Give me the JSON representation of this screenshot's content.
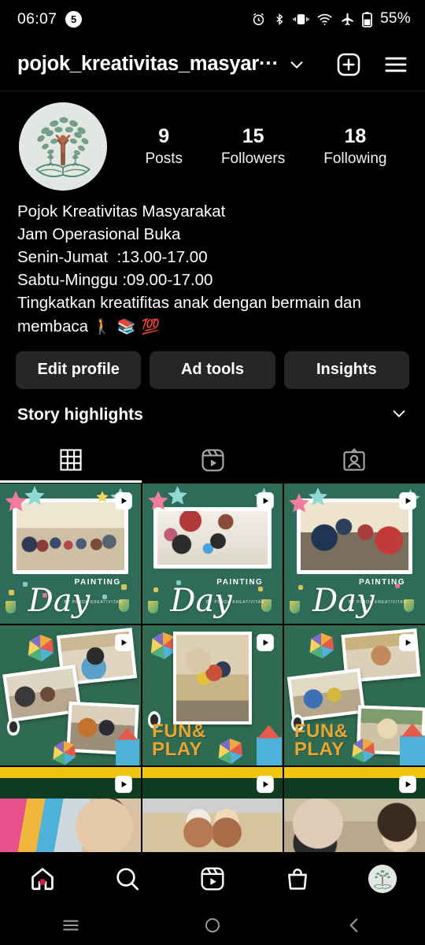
{
  "status_bar": {
    "time": "06:07",
    "notification_count": "5",
    "battery_percent": "55%",
    "icons": [
      "alarm-icon",
      "bluetooth-icon",
      "vibrate-icon",
      "wifi-icon",
      "airplane-mode-icon",
      "battery-icon"
    ]
  },
  "app_header": {
    "username": "pojok_kreativitas_masyar···",
    "dropdown_icon": "chevron-down-icon",
    "create_icon": "plus-square-icon",
    "menu_icon": "hamburger-menu-icon"
  },
  "profile": {
    "avatar_alt": "tree-and-book-logo",
    "stats": [
      {
        "value": "9",
        "label": "Posts"
      },
      {
        "value": "15",
        "label": "Followers"
      },
      {
        "value": "18",
        "label": "Following"
      }
    ],
    "bio": {
      "name": "Pojok Kreativitas Masyarakat",
      "line2": "Jam Operasional Buka",
      "line3": "Senin-Jumat  :13.00-17.00",
      "line4": "Sabtu-Minggu :09.00-17.00",
      "line5": "Tingkatkan kreatifitas anak dengan bermain dan membaca",
      "emojis": "🚶 📚 💯"
    },
    "buttons": [
      {
        "label": "Edit profile"
      },
      {
        "label": "Ad tools"
      },
      {
        "label": "Insights"
      }
    ],
    "highlights": {
      "title": "Story highlights",
      "expand_icon": "chevron-down-icon"
    }
  },
  "tabs": [
    {
      "name": "grid",
      "icon": "grid-icon",
      "active": true
    },
    {
      "name": "reels",
      "icon": "reels-icon",
      "active": false
    },
    {
      "name": "tagged",
      "icon": "tagged-person-icon",
      "active": false
    }
  ],
  "grid_posts": [
    {
      "id": 1,
      "template": "painting-day",
      "caption_script": "Day",
      "caption_caps": "PAINTING",
      "caption_sub": "BY POJOK KREATIVITAS",
      "is_reel": true
    },
    {
      "id": 2,
      "template": "painting-day",
      "caption_script": "Day",
      "caption_caps": "PAINTING",
      "caption_sub": "BY POJOK KREATIVITAS",
      "is_reel": true
    },
    {
      "id": 3,
      "template": "painting-day",
      "caption_script": "Day",
      "caption_caps": "PAINTING",
      "caption_sub": "BY POJOK KREATIVITAS",
      "is_reel": true
    },
    {
      "id": 4,
      "template": "fun-play",
      "caption_line1": "FUN&",
      "caption_line2": "PLAY",
      "is_reel": true
    },
    {
      "id": 5,
      "template": "fun-play",
      "caption_line1": "FUN&",
      "caption_line2": "PLAY",
      "is_reel": true
    },
    {
      "id": 6,
      "template": "fun-play",
      "caption_line1": "FUN&",
      "caption_line2": "PLAY",
      "is_reel": true
    },
    {
      "id": 7,
      "template": "video-row",
      "is_reel": true
    },
    {
      "id": 8,
      "template": "video-row",
      "is_reel": true
    },
    {
      "id": 9,
      "template": "video-row",
      "is_reel": true
    }
  ],
  "bottom_nav": [
    {
      "name": "home",
      "icon": "home-icon",
      "has_badge": true
    },
    {
      "name": "search",
      "icon": "search-icon",
      "has_badge": false
    },
    {
      "name": "reels",
      "icon": "reels-icon",
      "has_badge": false
    },
    {
      "name": "shop",
      "icon": "shopping-bag-icon",
      "has_badge": false
    },
    {
      "name": "profile",
      "icon": "profile-avatar-icon",
      "has_badge": false
    }
  ],
  "android_nav": [
    {
      "name": "recents",
      "icon": "recents-icon"
    },
    {
      "name": "home",
      "icon": "home-circle-icon"
    },
    {
      "name": "back",
      "icon": "back-chevron-icon"
    }
  ],
  "colors": {
    "background": "#000000",
    "button_bg": "#262626",
    "post_green": "#2e6b58",
    "post_dark_green": "#0e3d22",
    "accent_yellow": "#e8a530",
    "badge_red": "#c21f3a"
  }
}
